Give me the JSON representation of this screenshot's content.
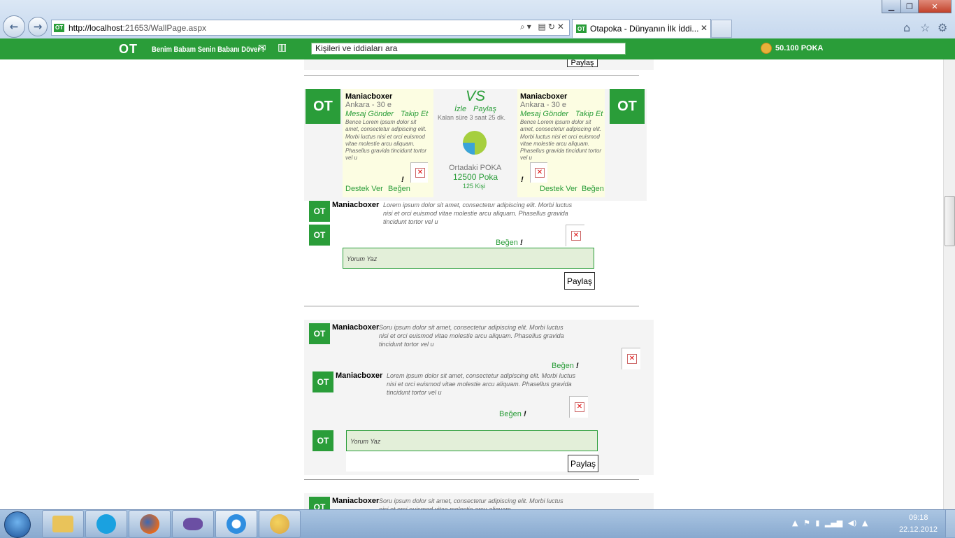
{
  "browser": {
    "url_host": "http://localhost",
    "url_rest": ":21653/WallPage.aspx",
    "tab_title": "Otapoka - Dünyanın İlk İddi...",
    "tab_favicon": "OT",
    "url_favicon": "OT",
    "url_controls": "⌕▾ ▤↻✕",
    "tab_close": "✕",
    "back": "←",
    "forward": "→",
    "minimize": "▁",
    "maximize": "❐",
    "close": "✕",
    "home_icon": "⌂",
    "favorites_icon": "☆",
    "tools_icon": "⚙"
  },
  "site": {
    "logo": "OT",
    "slogan": "Benim Babam Senin Babanı Döver !",
    "mail_icon": "✉",
    "stats_icon": "▥",
    "search_placeholder": "Kişileri ve iddiaları ara",
    "balance": "50.100 POKA"
  },
  "top_fragment": {
    "share_label": "Paylaş"
  },
  "bet": {
    "avatar_text": "OT",
    "vs_label": "VS",
    "watch_label": "İzle",
    "share_label": "Paylaş",
    "time_left": "Kalan süre 3 saat 25 dk.",
    "pot_label": "Ortadaki POKA",
    "pot_amount": "12500 Poka",
    "pot_people": "125 Kişi",
    "pie_share_a": 0.75,
    "pie_color_a": "#a6cf3e",
    "pie_color_b": "#3aa3d9",
    "left": {
      "name": "Maniacboxer",
      "location": "Ankara - 30 e",
      "message": "Mesaj Gönder",
      "follow": "Takip Et",
      "text": "Bence Lorem ipsum dolor sit amet, consectetur adipiscing elit. Morbi luctus nisi et orci euismod vitae molestie arcu aliquam. Phasellus gravida tincidunt tortor vel u",
      "exclaim": "!",
      "support": "Destek Ver",
      "like": "Beğen"
    },
    "right": {
      "name": "Maniacboxer",
      "location": "Ankara - 30 e",
      "message": "Mesaj Gönder",
      "follow": "Takip Et",
      "text": "Bence Lorem ipsum dolor sit amet, consectetur adipiscing elit. Morbi luctus nisi et orci euismod vitae molestie arcu aliquam. Phasellus gravida tincidunt tortor vel u",
      "exclaim": "!",
      "support": "Destek Ver",
      "like": "Beğen"
    },
    "comment": {
      "name": "Maniacboxer",
      "text": "Lorem ipsum dolor sit amet, consectetur adipiscing elit. Morbi luctus nisi et orci euismod vitae molestie arcu aliquam. Phasellus gravida tincidunt tortor vel u",
      "like": "Beğen",
      "exclaim": "!"
    },
    "comment_placeholder": "Yorum Yaz",
    "post_button": "Paylaş"
  },
  "post2": {
    "avatar_text": "OT",
    "name": "Maniacboxer",
    "text": "Soru ipsum dolor sit amet, consectetur adipiscing elit. Morbi luctus nisi et orci euismod vitae molestie arcu aliquam. Phasellus gravida tincidunt tortor vel u",
    "like": "Beğen",
    "exclaim": "!",
    "reply": {
      "name": "Maniacboxer",
      "text": "Lorem ipsum dolor sit amet, consectetur adipiscing elit. Morbi luctus nisi et orci euismod vitae molestie arcu aliquam. Phasellus gravida tincidunt tortor vel u",
      "like": "Beğen",
      "exclaim": "!"
    },
    "comment_placeholder": "Yorum Yaz",
    "post_button": "Paylaş"
  },
  "post3": {
    "avatar_text": "OT",
    "name": "Maniacboxer",
    "text": "Soru ipsum dolor sit amet, consectetur adipiscing elit. Morbi luctus nisi et orci euismod vitae molestie arcu aliquam."
  },
  "taskbar": {
    "time": "09:18",
    "date": "22.12.2012",
    "tray_icons": "▲ ⚑ ▮ ▂▄▆ ◀) ▲"
  }
}
